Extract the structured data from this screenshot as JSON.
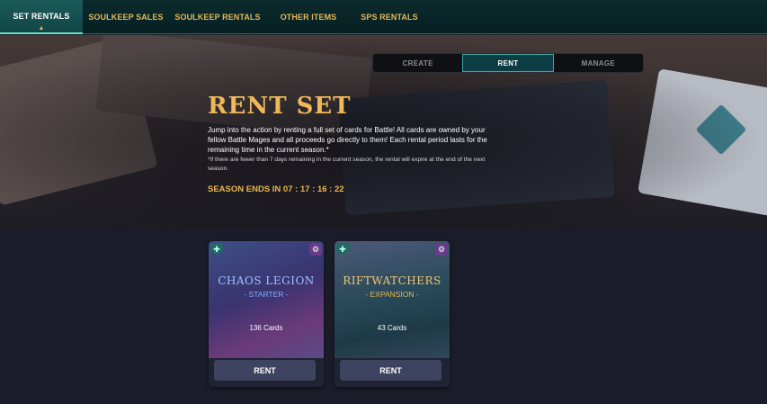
{
  "nav": {
    "tabs": [
      {
        "label": "SET RENTALS"
      },
      {
        "label": "SOULKEEP SALES"
      },
      {
        "label": "SOULKEEP RENTALS"
      },
      {
        "label": "OTHER ITEMS"
      },
      {
        "label": "SPS RENTALS"
      }
    ],
    "active_index": 0
  },
  "mode_switch": {
    "options": [
      {
        "label": "CREATE"
      },
      {
        "label": "RENT"
      },
      {
        "label": "MANAGE"
      }
    ],
    "active_index": 1
  },
  "hero": {
    "title": "RENT SET",
    "description": "Jump into the action by renting a full set of cards for Battle! All cards are owned by your fellow Battle Mages and all proceeds go directly to them! Each rental period lasts for the remaining time in the current season.*",
    "note": "*If there are fewer than 7 days remaining in the current season, the rental will expire at the end of the next season.",
    "season_ends": "SEASON ENDS IN 07 : 17 : 16 : 22"
  },
  "sets": [
    {
      "title": "CHAOS LEGION",
      "subtitle": "- STARTER -",
      "cards": "136 Cards",
      "button": "RENT",
      "title_color": "#9fc4ff",
      "subtitle_color": "#7fb0ff"
    },
    {
      "title": "RIFTWATCHERS",
      "subtitle": "- EXPANSION -",
      "cards": "43 Cards",
      "button": "RENT",
      "title_color": "#f0c674",
      "subtitle_color": "#e9b64f"
    }
  ],
  "icons": {
    "shield": "shield-icon",
    "gear": "gear-icon",
    "caret": "caret-up-icon"
  }
}
